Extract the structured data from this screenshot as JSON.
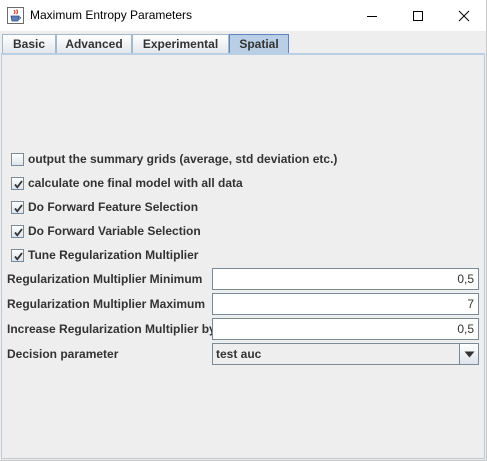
{
  "window": {
    "title": "Maximum Entropy Parameters",
    "app_icon": "java-cup-icon",
    "controls": [
      "minimize-icon",
      "maximize-icon",
      "close-icon"
    ]
  },
  "tabs": [
    {
      "label": "Basic",
      "selected": false
    },
    {
      "label": "Advanced",
      "selected": false
    },
    {
      "label": "Experimental",
      "selected": false
    },
    {
      "label": "Spatial",
      "selected": true
    }
  ],
  "checkboxes": [
    {
      "label": "output the summary grids (average, std deviation etc.)",
      "checked": false
    },
    {
      "label": "calculate one final model with all data",
      "checked": true
    },
    {
      "label": "Do Forward Feature Selection",
      "checked": true
    },
    {
      "label": "Do Forward Variable Selection",
      "checked": true
    },
    {
      "label": "Tune Regularization Multiplier",
      "checked": true
    }
  ],
  "fields": [
    {
      "label": "Regularization Multiplier Minimum",
      "value": "0,5"
    },
    {
      "label": "Regularization Multiplier Maximum",
      "value": "7"
    },
    {
      "label": "Increase Regularization Multiplier by",
      "value": "0,5"
    }
  ],
  "decision": {
    "label": "Decision parameter",
    "value": "test auc",
    "icon": "triangle-down-icon"
  },
  "colors": {
    "tab_selected": "#b8cfe5",
    "panel_background": "#eeeeee",
    "text": "#333333"
  }
}
